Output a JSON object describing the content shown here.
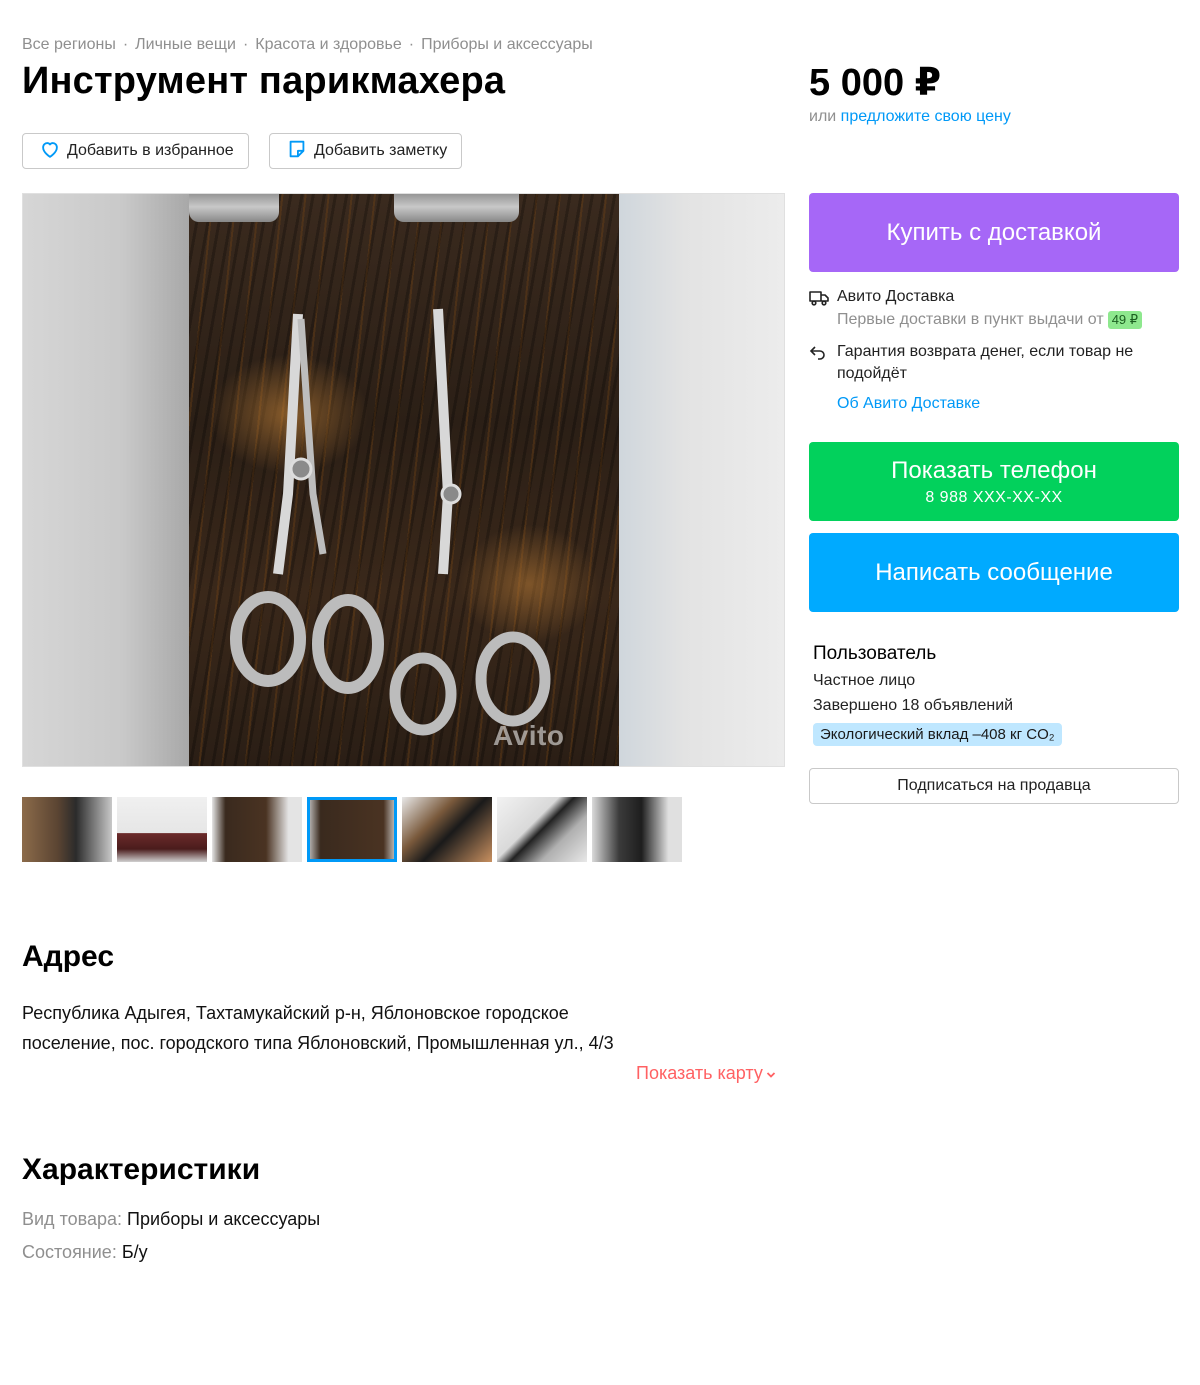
{
  "breadcrumbs": [
    "Все регионы",
    "Личные вещи",
    "Красота и здоровье",
    "Приборы и аксессуары"
  ],
  "title": "Инструмент парикмахера",
  "price": {
    "value": "5 000 ₽",
    "or_text": "или",
    "offer_link": "предложите свою цену"
  },
  "actions": {
    "favorite_label": "Добавить в избранное",
    "note_label": "Добавить заметку"
  },
  "gallery": {
    "watermark": "Avito",
    "thumbnail_count": 7,
    "active_index": 3
  },
  "buy": {
    "label": "Купить с доставкой"
  },
  "delivery": {
    "title": "Авито Доставка",
    "first_delivery_text": "Первые доставки в пункт выдачи от",
    "first_delivery_price": "49 ₽",
    "guarantee_text": "Гарантия возврата денег, если товар не подойдёт",
    "about_link": "Об Авито Доставке"
  },
  "phone": {
    "label": "Показать телефон",
    "number": "8 988 XXX-XX-XX"
  },
  "message": {
    "label": "Написать сообщение"
  },
  "seller": {
    "name": "Пользователь",
    "type": "Частное лицо",
    "completed": "Завершено 18 объявлений",
    "eco": "Экологический вклад –408 кг CO₂",
    "subscribe_label": "Подписаться на продавца"
  },
  "address": {
    "heading": "Адрес",
    "text": "Республика Адыгея, Тахтамукайский р-н, Яблоновское городское поселение, пос. городского типа Яблоновский, Промышленная ул., 4/3",
    "show_map": "Показать карту"
  },
  "specs": {
    "heading": "Характеристики",
    "items": [
      {
        "key": "Вид товара:",
        "value": "Приборы и аксессуары"
      },
      {
        "key": "Состояние:",
        "value": "Б/у"
      }
    ]
  },
  "colors": {
    "buy": "#a667f7",
    "phone": "#02d15c",
    "message": "#00aaff",
    "link": "#0099f7",
    "map_link": "#ff6163"
  }
}
